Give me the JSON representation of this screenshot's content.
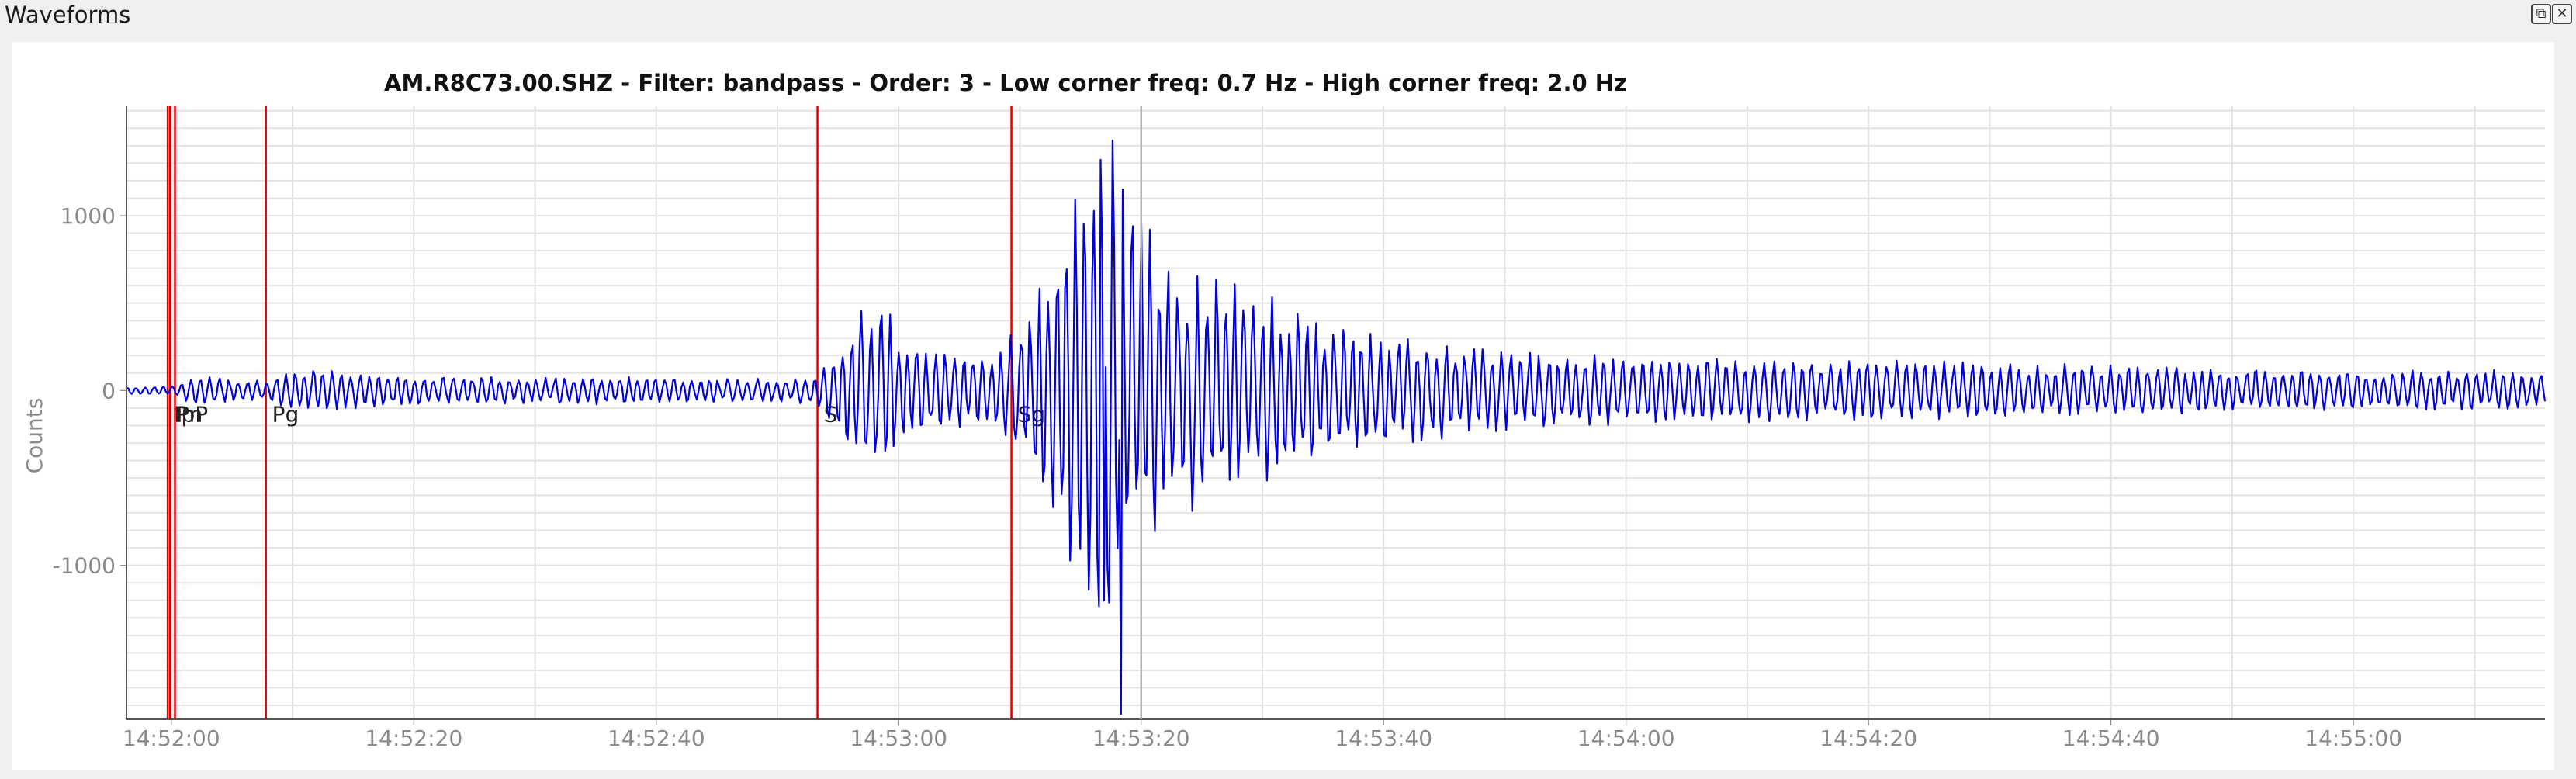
{
  "window": {
    "title": "Waveforms",
    "restore_glyph": "⧉",
    "close_glyph": "✕"
  },
  "chart_data": {
    "type": "line",
    "title": "AM.R8C73.00.SHZ - Filter: bandpass - Order: 3 - Low corner freq: 0.7 Hz - High corner freq: 2.0 Hz",
    "xlabel": "",
    "ylabel": "Counts",
    "xlim": [
      "14:51:56.3",
      "14:55:15.8"
    ],
    "ylim": [
      -1880,
      1630
    ],
    "x_ticks": [
      "14:52:00",
      "14:52:20",
      "14:52:40",
      "14:53:00",
      "14:53:20",
      "14:53:40",
      "14:54:00",
      "14:54:20",
      "14:54:40",
      "14:55:00"
    ],
    "y_ticks": [
      1000,
      0,
      -1000
    ],
    "grid": true,
    "series": [
      {
        "color": "#0000dd",
        "envelope": [
          [
            "14:51:56.3",
            20
          ],
          [
            "14:52:00.0",
            30
          ],
          [
            "14:52:02.0",
            90
          ],
          [
            "14:52:06.0",
            60
          ],
          [
            "14:52:08.0",
            60
          ],
          [
            "14:52:10.0",
            130
          ],
          [
            "14:52:14.0",
            110
          ],
          [
            "14:52:20.0",
            90
          ],
          [
            "14:52:30.0",
            80
          ],
          [
            "14:52:40.0",
            80
          ],
          [
            "14:52:50.0",
            70
          ],
          [
            "14:52:53.0",
            90
          ],
          [
            "14:52:55.0",
            260
          ],
          [
            "14:52:57.0",
            520
          ],
          [
            "14:52:59.0",
            480
          ],
          [
            "14:53:01.0",
            260
          ],
          [
            "14:53:05.0",
            230
          ],
          [
            "14:53:08.0",
            230
          ],
          [
            "14:53:10.0",
            420
          ],
          [
            "14:53:13.0",
            800
          ],
          [
            "14:53:15.0",
            1400
          ],
          [
            "14:53:17.0",
            1600
          ],
          [
            "14:53:19.0",
            1100
          ],
          [
            "14:53:23.0",
            750
          ],
          [
            "14:53:27.0",
            620
          ],
          [
            "14:53:31.0",
            560
          ],
          [
            "14:53:35.0",
            420
          ],
          [
            "14:53:40.0",
            340
          ],
          [
            "14:53:50.0",
            240
          ],
          [
            "14:54:00.0",
            200
          ],
          [
            "14:54:20.0",
            180
          ],
          [
            "14:54:40.0",
            150
          ],
          [
            "14:55:00.0",
            120
          ],
          [
            "14:55:15.8",
            120
          ]
        ],
        "peaks": [
          {
            "x": "14:53:17.7",
            "y": 1430
          },
          {
            "x": "14:53:18.4",
            "y": -1850
          },
          {
            "x": "14:53:16.6",
            "y": 1320
          },
          {
            "x": "14:53:16.9",
            "y": -1200
          }
        ]
      }
    ],
    "picks": [
      {
        "label": "P",
        "x": "14:51:59.7"
      },
      {
        "label": "Pn",
        "x": "14:51:59.9"
      },
      {
        "label": "pP",
        "x": "14:52:00.3"
      },
      {
        "label": "Pg",
        "x": "14:52:07.8"
      },
      {
        "label": "S",
        "x": "14:52:53.3"
      },
      {
        "label": "Sg",
        "x": "14:53:09.3"
      }
    ],
    "pick_color": "#e00000",
    "cursor": {
      "x": "14:53:20.0",
      "color": "#b0b0b0"
    }
  }
}
